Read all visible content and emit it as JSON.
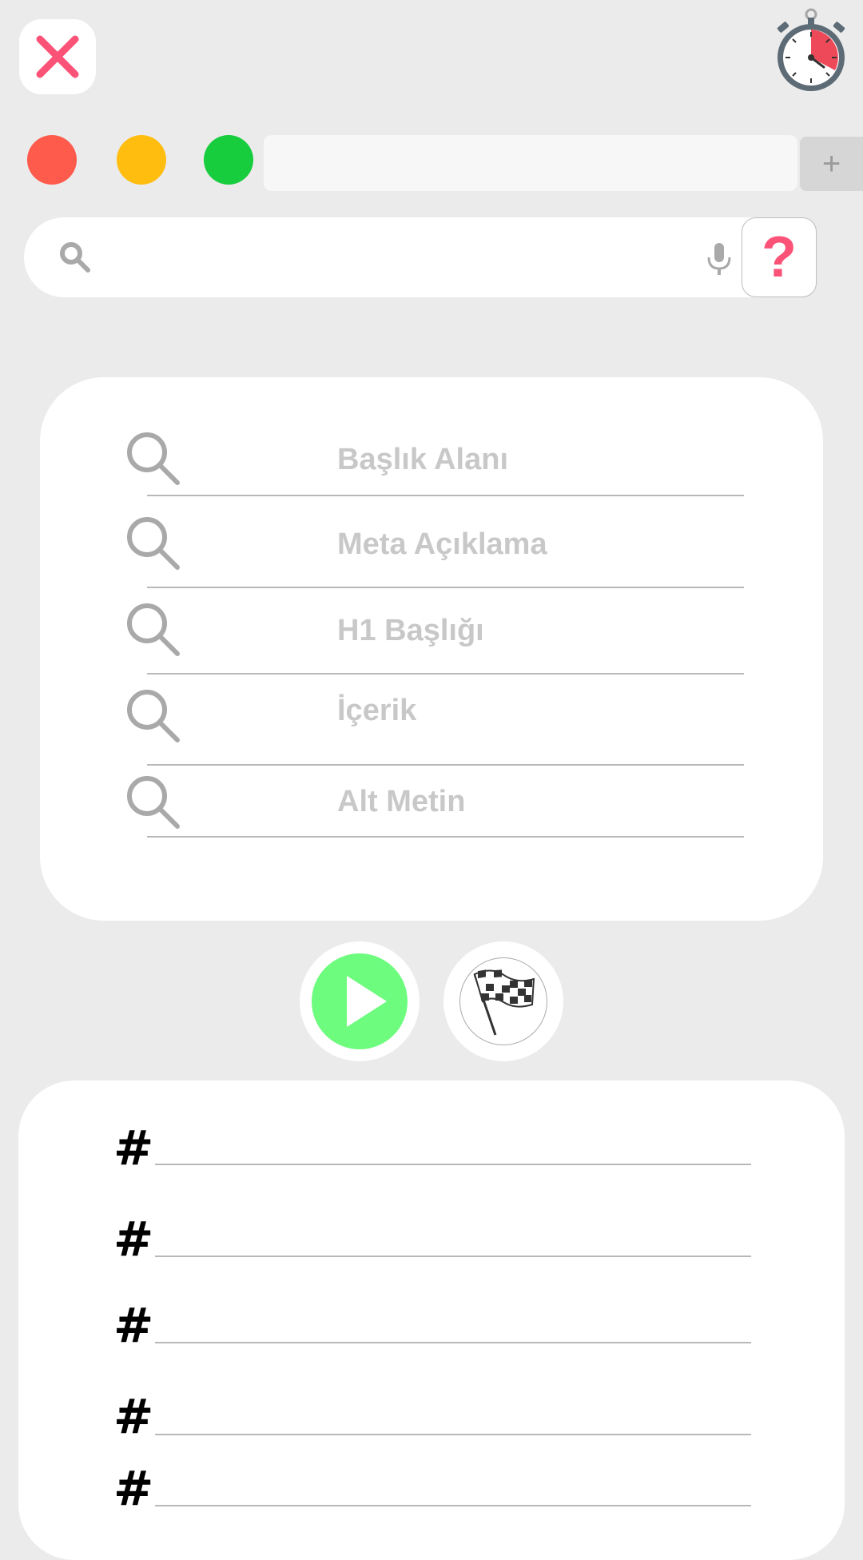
{
  "window": {
    "close_icon": "close-x-icon",
    "timer_icon": "stopwatch-icon",
    "traffic_lights": [
      "#fe5b4c",
      "#ffbd10",
      "#17cc3d"
    ],
    "url_value": "",
    "new_tab_label": "+"
  },
  "search": {
    "value": "",
    "search_icon": "search-icon",
    "mic_icon": "microphone-icon",
    "help_label": "?"
  },
  "fields": [
    {
      "label": "Başlık Alanı",
      "icon": "search-icon"
    },
    {
      "label": "Meta Açıklama",
      "icon": "search-icon"
    },
    {
      "label": "H1 Başlığı",
      "icon": "search-icon"
    },
    {
      "label": "İçerik",
      "icon": "search-icon"
    },
    {
      "label": "Alt Metin",
      "icon": "search-icon"
    }
  ],
  "actions": {
    "play_icon": "play-icon",
    "finish_icon": "checkered-flag-icon"
  },
  "hashtags": {
    "symbol": "#",
    "rows": [
      "",
      "",
      "",
      "",
      ""
    ]
  },
  "colors": {
    "accent_pink": "#fb5378",
    "play_green": "#6dfc7e",
    "placeholder_gray": "#c8c8c8"
  }
}
